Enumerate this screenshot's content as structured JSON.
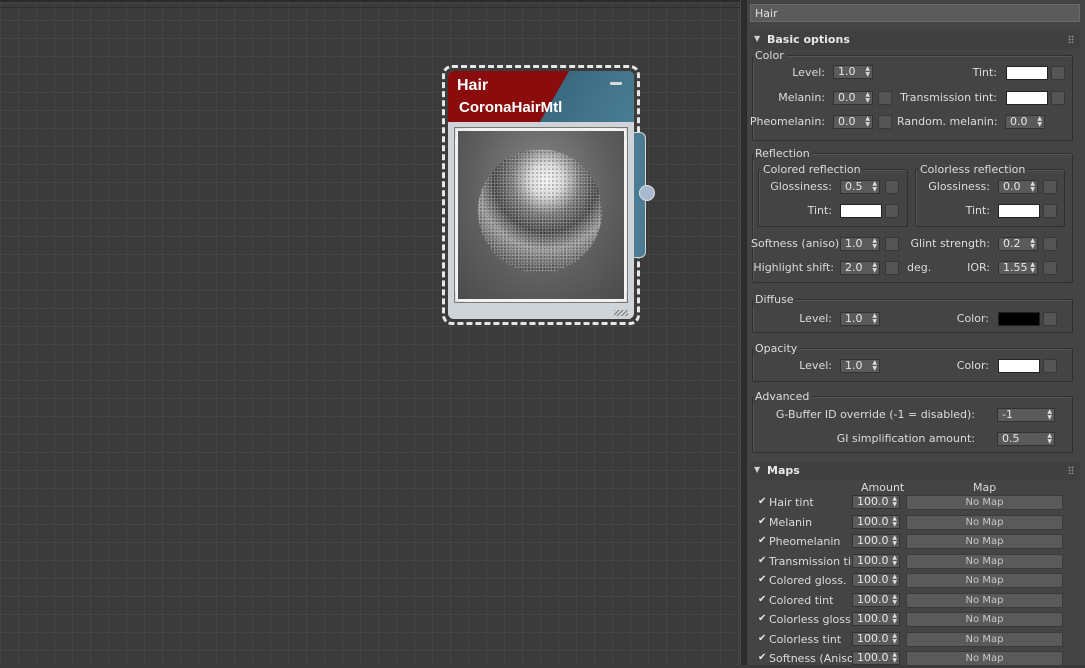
{
  "node": {
    "name": "Hair",
    "type": "CoronaHairMtl"
  },
  "panel": {
    "material_name": "Hair",
    "basic_options": {
      "title": "Basic options",
      "color": {
        "label": "Color",
        "level_label": "Level:",
        "level": "1.0",
        "tint_label": "Tint:",
        "tint_color": "#ffffff",
        "melanin_label": "Melanin:",
        "melanin": "0.0",
        "transmission_tint_label": "Transmission tint:",
        "transmission_tint_color": "#ffffff",
        "pheomelanin_label": "Pheomelanin:",
        "pheomelanin": "0.0",
        "random_melanin_label": "Random. melanin:",
        "random_melanin": "0.0"
      },
      "reflection": {
        "label": "Reflection",
        "colored_label": "Colored reflection",
        "colorless_label": "Colorless reflection",
        "glossiness_label": "Glossiness:",
        "colored_glossiness": "0.5",
        "colorless_glossiness": "0.0",
        "tint_label": "Tint:",
        "softness_label": "Softness (aniso):",
        "softness": "1.0",
        "glint_label": "Glint strength:",
        "glint": "0.2",
        "highlight_label": "Highlight shift:",
        "highlight": "2.0",
        "deg_label": "deg.",
        "ior_label": "IOR:",
        "ior": "1.55"
      },
      "diffuse": {
        "label": "Diffuse",
        "level_label": "Level:",
        "level": "1.0",
        "color_label": "Color:",
        "color": "#000000"
      },
      "opacity": {
        "label": "Opacity",
        "level_label": "Level:",
        "level": "1.0",
        "color_label": "Color:",
        "color": "#ffffff"
      },
      "advanced": {
        "label": "Advanced",
        "gbuffer_label": "G-Buffer ID override (-1 = disabled):",
        "gbuffer": "-1",
        "gi_label": "GI simplification amount:",
        "gi": "0.5"
      }
    },
    "maps": {
      "title": "Maps",
      "amount_header": "Amount",
      "map_header": "Map",
      "rows": [
        {
          "name": "Hair tint",
          "amount": "100.0",
          "map": "No Map",
          "checked": "✔"
        },
        {
          "name": "Melanin",
          "amount": "100.0",
          "map": "No Map",
          "checked": "✔"
        },
        {
          "name": "Pheomelanin",
          "amount": "100.0",
          "map": "No Map",
          "checked": "✔"
        },
        {
          "name": "Transmission tint",
          "amount": "100.0",
          "map": "No Map",
          "checked": "✔"
        },
        {
          "name": "Colored gloss.",
          "amount": "100.0",
          "map": "No Map",
          "checked": "✔"
        },
        {
          "name": "Colored tint",
          "amount": "100.0",
          "map": "No Map",
          "checked": "✔"
        },
        {
          "name": "Colorless gloss.",
          "amount": "100.0",
          "map": "No Map",
          "checked": "✔"
        },
        {
          "name": "Colorless tint",
          "amount": "100.0",
          "map": "No Map",
          "checked": "✔"
        },
        {
          "name": "Softness (Aniso)",
          "amount": "100.0",
          "map": "No Map",
          "checked": "✔"
        }
      ]
    }
  },
  "colors": {
    "node_header_red": "#8a0c0c",
    "node_header_blue": "#4a7d94",
    "panel_bg": "#444444",
    "canvas_bg": "#3b3b3b"
  }
}
